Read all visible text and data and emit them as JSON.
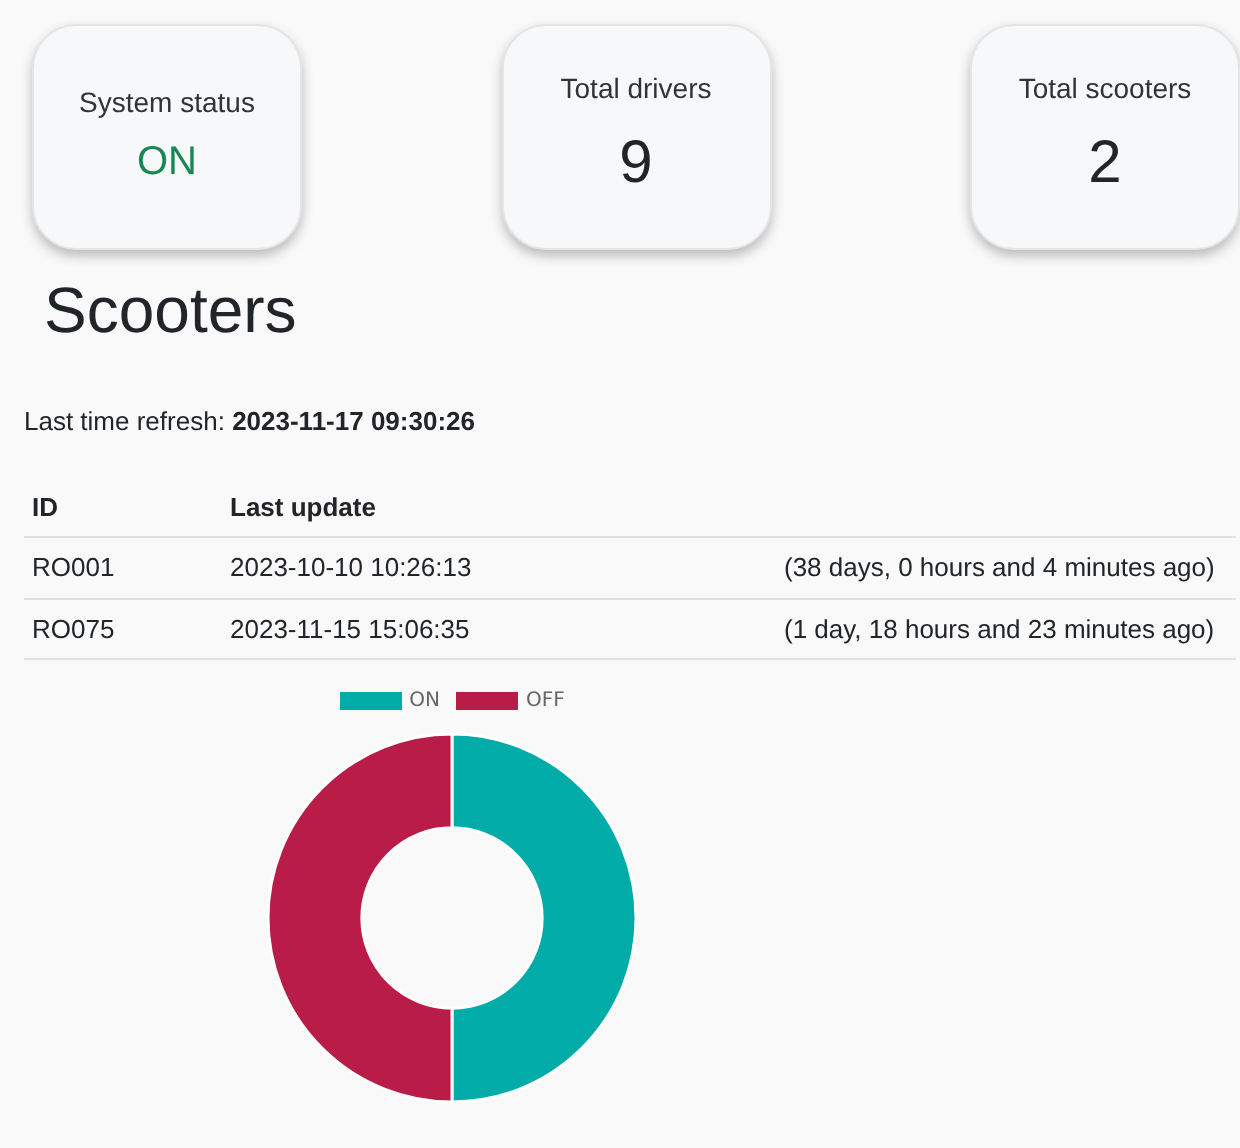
{
  "cards": [
    {
      "label": "System status",
      "value": "ON",
      "kind": "status"
    },
    {
      "label": "Total drivers",
      "value": "9",
      "kind": "count"
    },
    {
      "label": "Total scooters",
      "value": "2",
      "kind": "count"
    }
  ],
  "heading": "Scooters",
  "refresh": {
    "label": "Last time refresh:",
    "value": "2023-11-17 09:30:26"
  },
  "table": {
    "columns": [
      "ID",
      "Last update"
    ],
    "rows": [
      {
        "id": "RO001",
        "last_update": "2023-10-10 10:26:13",
        "ago": "(38 days, 0 hours and 4 minutes ago)"
      },
      {
        "id": "RO075",
        "last_update": "2023-11-15 15:06:35",
        "ago": "(1 day, 18 hours and 23 minutes ago)"
      }
    ]
  },
  "chart": {
    "chart_data": {
      "type": "donut",
      "categories": [
        "ON",
        "OFF"
      ],
      "legend": "top",
      "series": [
        {
          "colors": [
            "#00aba8",
            "#b81c47"
          ],
          "values": [
            50,
            50
          ]
        }
      ]
    }
  }
}
